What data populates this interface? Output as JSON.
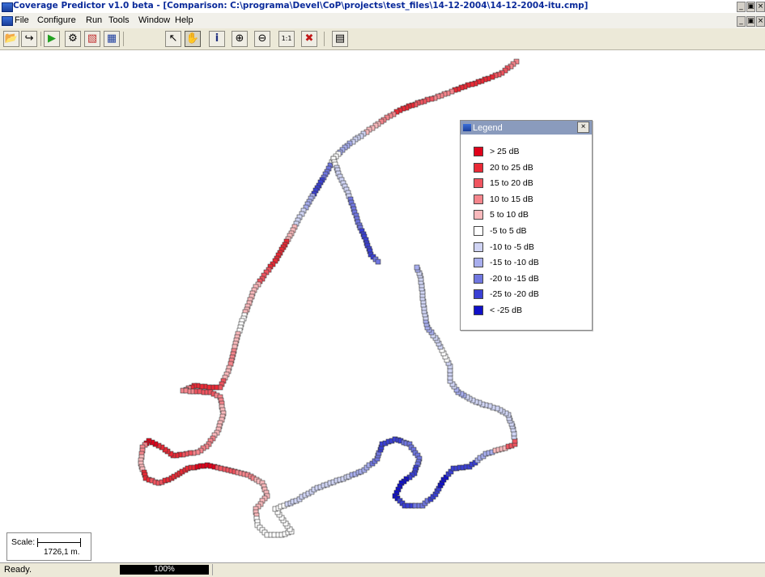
{
  "window": {
    "title": "Coverage Predictor v1.0 beta - [Comparison: C:\\programa\\Devel\\CoP\\projects\\test_files\\14-12-2004\\14-12-2004-itu.cmp]",
    "controls": [
      "_",
      "▣",
      "×"
    ]
  },
  "menu": [
    "File",
    "Configure",
    "Run",
    "Tools",
    "Window",
    "Help"
  ],
  "toolbar": {
    "buttons": [
      {
        "name": "open-icon",
        "glyph": "📂"
      },
      {
        "name": "export-icon",
        "glyph": "↪"
      },
      {
        "name": "run-icon",
        "glyph": "▶"
      },
      {
        "name": "configure-icon",
        "glyph": "⚙"
      },
      {
        "name": "layer-icon",
        "glyph": "▧"
      },
      {
        "name": "map-icon",
        "glyph": "▦"
      },
      {
        "name": "pointer-icon",
        "glyph": "↖"
      },
      {
        "name": "pan-hand-icon",
        "glyph": "✋"
      },
      {
        "name": "info-icon",
        "glyph": "i"
      },
      {
        "name": "zoom-in-icon",
        "glyph": "⊕"
      },
      {
        "name": "zoom-out-icon",
        "glyph": "⊖"
      },
      {
        "name": "zoom-1to1-icon",
        "glyph": "1:1"
      },
      {
        "name": "clear-icon",
        "glyph": "✖"
      },
      {
        "name": "legend-toggle-icon",
        "glyph": "▤"
      }
    ]
  },
  "legend": {
    "title": "Legend",
    "close": "×",
    "items": [
      {
        "label": "> 25 dB",
        "color": "#e0001a"
      },
      {
        "label": "20 to 25 dB",
        "color": "#ea2a36"
      },
      {
        "label": "15 to 20 dB",
        "color": "#f05560"
      },
      {
        "label": "10 to 15 dB",
        "color": "#f5858c"
      },
      {
        "label": "5 to 10 dB",
        "color": "#f9b9bc"
      },
      {
        "label": "-5 to 5 dB",
        "color": "#ffffff"
      },
      {
        "label": "-10 to -5 dB",
        "color": "#d0d4f4"
      },
      {
        "label": "-15 to -10 dB",
        "color": "#a8aeee"
      },
      {
        "label": "-20 to -15 dB",
        "color": "#7077e0"
      },
      {
        "label": "-25 to -20 dB",
        "color": "#3a40d4"
      },
      {
        "label": "< -25 dB",
        "color": "#1010c8"
      }
    ]
  },
  "scale": {
    "label": "Scale:",
    "value": "1726,1 m."
  },
  "status": {
    "text": "Ready.",
    "progress": "100%",
    "progress_fraction": 1.0
  }
}
